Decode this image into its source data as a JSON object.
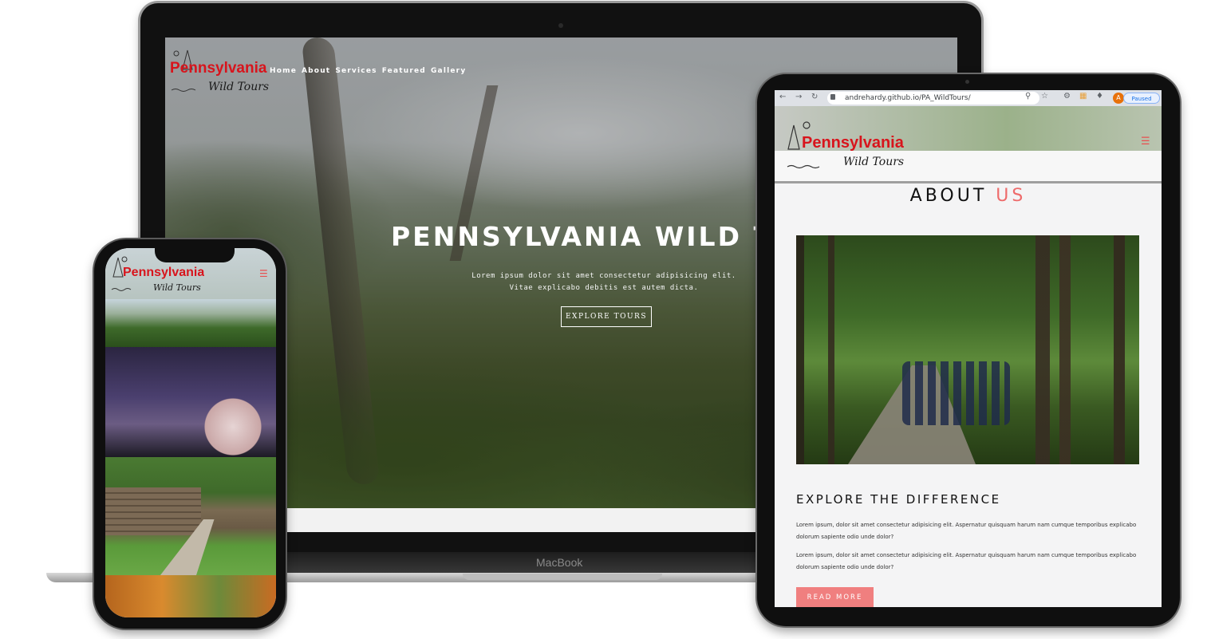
{
  "laptop": {
    "brand_label": "MacBook",
    "logo": {
      "line1": "Pennsylvania",
      "line2": "Wild Tours"
    },
    "nav": [
      "Home",
      "About",
      "Services",
      "Featured",
      "Gallery"
    ],
    "hero_title": "PENNSYLVANIA WILD TO",
    "hero_text": "Lorem ipsum dolor sit amet consectetur adipisicing elit. Vitae explicabo debitis est autem dicta.",
    "hero_button": "EXPLORE TOURS"
  },
  "phone": {
    "logo": {
      "line1": "Pennsylvania",
      "line2": "Wild Tours"
    },
    "menu_icon": "hamburger-icon"
  },
  "tablet": {
    "browser": {
      "url": "andrehardy.github.io/PA_WildTours/",
      "avatar_letter": "A",
      "status": "Paused"
    },
    "logo": {
      "line1": "Pennsylvania",
      "line2": "Wild Tours"
    },
    "menu_icon": "hamburger-icon",
    "about_title_main": "ABOUT",
    "about_title_accent": "US",
    "section_heading": "EXPLORE THE DIFFERENCE",
    "paragraph1": "Lorem ipsum, dolor sit amet consectetur adipisicing elit. Aspernatur quisquam harum nam cumque temporibus explicabo dolorum sapiente odio unde dolor?",
    "paragraph2": "Lorem ipsum, dolor sit amet consectetur adipisicing elit. Aspernatur quisquam harum nam cumque temporibus explicabo dolorum sapiente odio unde dolor?",
    "button": "READ MORE"
  },
  "colors": {
    "accent": "#ee6b6b",
    "logo_red": "#d8141c",
    "button": "#f07f7f"
  }
}
